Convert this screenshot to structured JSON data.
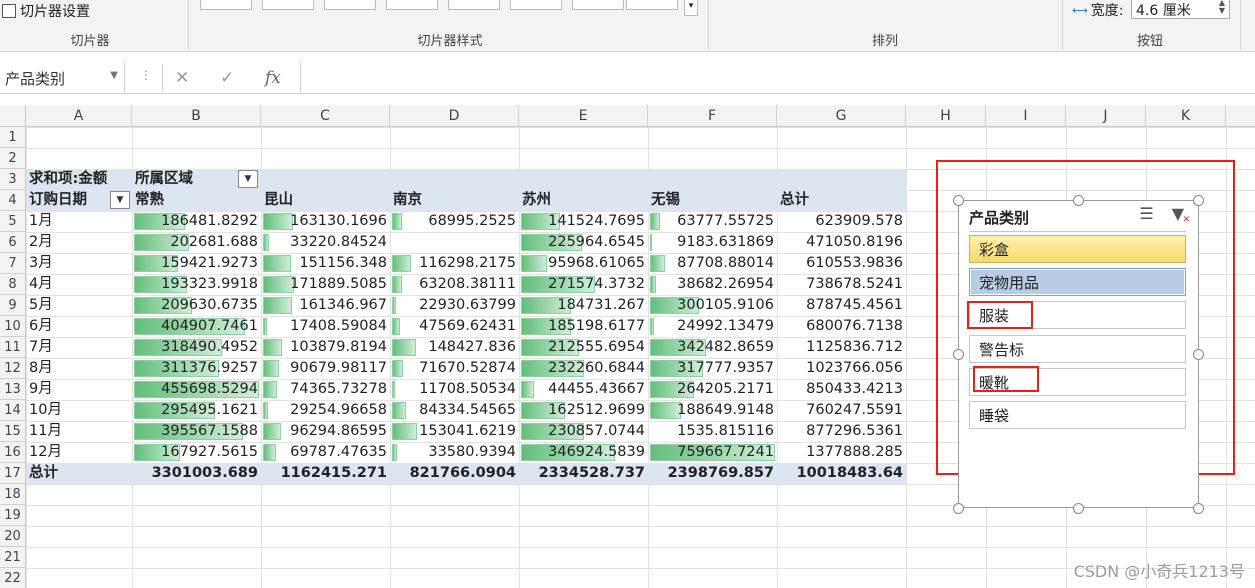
{
  "ribbon": {
    "slicer_settings_label": "切片器设置",
    "groups": [
      "切片器",
      "切片器样式",
      "排列",
      "按钮"
    ],
    "width_label": "宽度:",
    "width_value": "4.6 厘米"
  },
  "formula_bar": {
    "name_box": "产品类别",
    "cancel_icon": "✕",
    "enter_icon": "✓",
    "fx_icon": "fx",
    "formula": ""
  },
  "columns": [
    "A",
    "B",
    "C",
    "D",
    "E",
    "F",
    "G",
    "H",
    "I",
    "J",
    "K"
  ],
  "rows": [
    "1",
    "2",
    "3",
    "4",
    "5",
    "6",
    "7",
    "8",
    "9",
    "10",
    "11",
    "12",
    "13",
    "14",
    "15",
    "16",
    "17",
    "18",
    "19",
    "20",
    "21",
    "22"
  ],
  "pivot": {
    "value_label": "求和项:金额",
    "col_field": "所属区域",
    "row_field": "订购日期",
    "col_headers": [
      "常熟",
      "昆山",
      "南京",
      "苏州",
      "无锡",
      "总计"
    ],
    "body": [
      {
        "label": "1月",
        "values": [
          "186481.8292",
          "163130.1696",
          "68995.2525",
          "141524.7695",
          "63777.55725",
          "623909.578"
        ],
        "bars": [
          0.41,
          0.24,
          0.08,
          0.31,
          0.08
        ]
      },
      {
        "label": "2月",
        "values": [
          "202681.688",
          "33220.84524",
          "",
          "225964.6545",
          "9183.631869",
          "471050.8196"
        ],
        "bars": [
          0.44,
          0.05,
          0,
          0.49,
          0.01
        ]
      },
      {
        "label": "3月",
        "values": [
          "159421.9273",
          "151156.348",
          "116298.2175",
          "95968.61065",
          "87708.88014",
          "610553.9836"
        ],
        "bars": [
          0.35,
          0.22,
          0.15,
          0.21,
          0.12
        ]
      },
      {
        "label": "4月",
        "values": [
          "193323.9918",
          "171889.5085",
          "63208.38111",
          "271574.3732",
          "38682.26954",
          "738678.5241"
        ],
        "bars": [
          0.42,
          0.25,
          0.08,
          0.59,
          0.05
        ]
      },
      {
        "label": "5月",
        "values": [
          "209630.6735",
          "161346.967",
          "22930.63799",
          "184731.267",
          "300105.9106",
          "878745.4561"
        ],
        "bars": [
          0.46,
          0.23,
          0.03,
          0.4,
          0.39
        ]
      },
      {
        "label": "6月",
        "values": [
          "404907.7461",
          "17408.59084",
          "47569.62431",
          "185198.6177",
          "24992.13479",
          "680076.7138"
        ],
        "bars": [
          0.89,
          0.03,
          0.06,
          0.4,
          0.03
        ]
      },
      {
        "label": "7月",
        "values": [
          "318490.4952",
          "103879.8194",
          "148427.836",
          "212555.6954",
          "342482.8659",
          "1125836.712"
        ],
        "bars": [
          0.7,
          0.15,
          0.19,
          0.46,
          0.45
        ]
      },
      {
        "label": "8月",
        "values": [
          "311376.9257",
          "90679.98117",
          "71670.52874",
          "232260.6844",
          "317777.9357",
          "1023766.056"
        ],
        "bars": [
          0.68,
          0.13,
          0.09,
          0.5,
          0.42
        ]
      },
      {
        "label": "9月",
        "values": [
          "455698.5294",
          "74365.73278",
          "11708.50534",
          "44455.43667",
          "264205.2171",
          "850433.4213"
        ],
        "bars": [
          1.0,
          0.11,
          0.02,
          0.1,
          0.35
        ]
      },
      {
        "label": "10月",
        "values": [
          "295495.1621",
          "29254.96658",
          "84334.54565",
          "162512.9699",
          "188649.9148",
          "760247.5591"
        ],
        "bars": [
          0.65,
          0.04,
          0.11,
          0.35,
          0.25
        ]
      },
      {
        "label": "11月",
        "values": [
          "395567.1588",
          "96294.86595",
          "153041.6219",
          "230857.0744",
          "1535.815116",
          "877296.5361"
        ],
        "bars": [
          0.87,
          0.14,
          0.2,
          0.5,
          0.0
        ]
      },
      {
        "label": "12月",
        "values": [
          "167927.5615",
          "69787.47635",
          "33580.9394",
          "346924.5839",
          "759667.7241",
          "1377888.285"
        ],
        "bars": [
          0.37,
          0.1,
          0.04,
          0.75,
          1.0
        ]
      }
    ],
    "total_label": "总计",
    "totals": [
      "3301003.689",
      "1162415.271",
      "821766.0904",
      "2334528.737",
      "2398769.857",
      "10018483.64"
    ]
  },
  "slicer": {
    "title": "产品类别",
    "items": [
      "彩盒",
      "宠物用品",
      "服装",
      "警告标",
      "暖靴",
      "睡袋"
    ],
    "selected_item": "彩盒",
    "hover_item": "宠物用品"
  },
  "watermark": "CSDN @小奇兵1213号",
  "colors": {
    "header_band": "#dce6f1",
    "databar": "#63be7b",
    "highlight_box": "#e8201a",
    "slicer_selected": "#f7d96b",
    "slicer_hover": "#b8cce4"
  }
}
